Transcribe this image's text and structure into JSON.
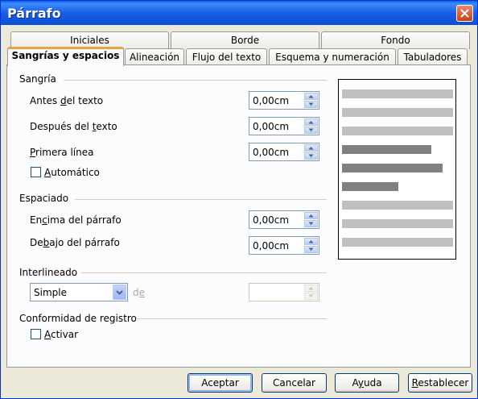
{
  "window": {
    "title": "Párrafo"
  },
  "tabs": {
    "row1": [
      {
        "label": "Iniciales",
        "active": false
      },
      {
        "label": "Borde",
        "active": false
      },
      {
        "label": "Fondo",
        "active": false
      }
    ],
    "row2": [
      {
        "label": "Sangrías y espacios",
        "active": true
      },
      {
        "label": "Alineación",
        "active": false
      },
      {
        "label": "Flujo del texto",
        "active": false
      },
      {
        "label": "Esquema y numeración",
        "active": false
      },
      {
        "label": "Tabuladores",
        "active": false
      }
    ]
  },
  "sangria": {
    "title": "Sangría",
    "antes": {
      "pre": "Antes ",
      "u": "d",
      "post": "el texto",
      "value": "0,00cm"
    },
    "despues": {
      "pre": "Después del ",
      "u": "t",
      "post": "exto",
      "value": "0,00cm"
    },
    "primera": {
      "pre": "",
      "u": "P",
      "post": "rimera línea",
      "value": "0,00cm"
    },
    "automatico": {
      "pre": "",
      "u": "A",
      "post": "utomático",
      "checked": false
    }
  },
  "espaciado": {
    "title": "Espaciado",
    "encima": {
      "pre": "En",
      "u": "c",
      "post": "ima del párrafo",
      "value": "0,00cm"
    },
    "debajo": {
      "pre": "De",
      "u": "b",
      "post": "ajo del párrafo",
      "value": "0,00cm"
    }
  },
  "interlineado": {
    "title": "Interlineado",
    "selected": "Simple",
    "de_pre": "d",
    "de_u": "e",
    "de_value": ""
  },
  "registro": {
    "title": "Conformidad de registro",
    "activar": {
      "pre": "",
      "u": "A",
      "post": "ctivar",
      "checked": false
    }
  },
  "preview": {
    "colors": {
      "light": "#c0c0c0",
      "dark": "#808080"
    }
  },
  "buttons": {
    "aceptar": "Aceptar",
    "cancelar": "Cancelar",
    "ayuda_pre": "A",
    "ayuda_u": "y",
    "ayuda_post": "uda",
    "restablecer_pre": "",
    "restablecer_u": "R",
    "restablecer_post": "establecer"
  },
  "colors": {
    "titlebar": "#0a5fe4",
    "tab_highlight": "#e8a33f",
    "dialog_bg": "#ece9d8"
  }
}
